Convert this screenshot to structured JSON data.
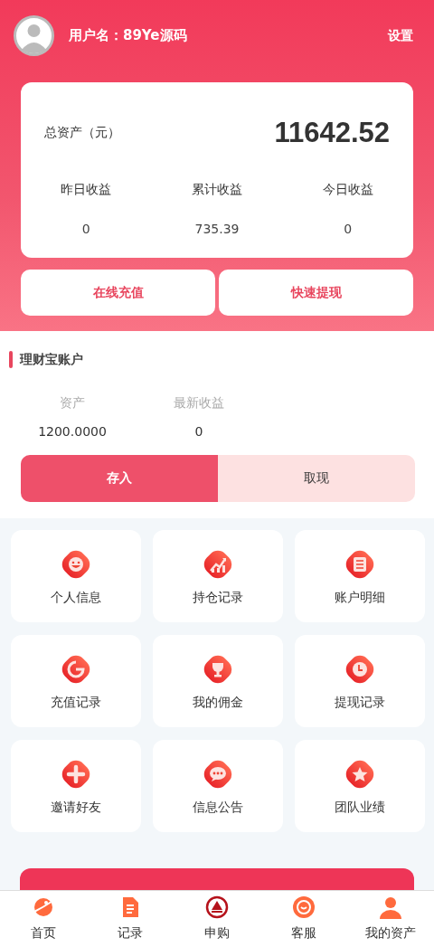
{
  "header": {
    "username": "用户名：89Ye源码",
    "settings": "设置"
  },
  "summary": {
    "total_label": "总资产（元）",
    "total_value": "11642.52",
    "stats": [
      {
        "label": "昨日收益",
        "value": "0"
      },
      {
        "label": "累计收益",
        "value": "735.39"
      },
      {
        "label": "今日收益",
        "value": "0"
      }
    ]
  },
  "actions": [
    "在线充值",
    "快速提现"
  ],
  "wallet": {
    "title": "理财宝账户",
    "stats": [
      {
        "label": "资产",
        "value": "1200.0000"
      },
      {
        "label": "最新收益",
        "value": "0"
      }
    ],
    "tabs": [
      {
        "label": "存入",
        "selected": true
      },
      {
        "label": "取现",
        "selected": false
      }
    ]
  },
  "menu": [
    {
      "label": "个人信息"
    },
    {
      "label": "持仓记录"
    },
    {
      "label": "账户明细"
    },
    {
      "label": "充值记录"
    },
    {
      "label": "我的佣金"
    },
    {
      "label": "提现记录"
    },
    {
      "label": "邀请好友"
    },
    {
      "label": "信息公告"
    },
    {
      "label": "团队业绩"
    }
  ],
  "tab_bar": [
    {
      "label": "首页"
    },
    {
      "label": "记录"
    },
    {
      "label": "申购"
    },
    {
      "label": "客服"
    },
    {
      "label": "我的资产"
    }
  ]
}
